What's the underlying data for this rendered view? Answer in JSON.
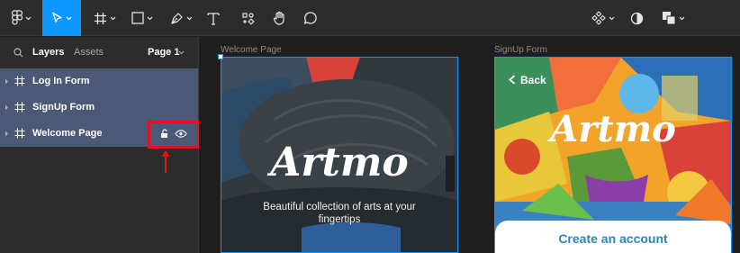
{
  "toolbar": {
    "tools": [
      {
        "name": "main-menu",
        "icon": "figma-logo-icon"
      },
      {
        "name": "move-tool",
        "icon": "cursor-arrow-icon",
        "active": true
      },
      {
        "name": "frame-tool",
        "icon": "hash-frame-icon"
      },
      {
        "name": "shape-tool",
        "icon": "rectangle-icon"
      },
      {
        "name": "pen-tool",
        "icon": "pen-nib-icon"
      },
      {
        "name": "text-tool",
        "icon": "text-t-icon"
      },
      {
        "name": "resources-tool",
        "icon": "resources-icon"
      },
      {
        "name": "hand-tool",
        "icon": "hand-icon"
      },
      {
        "name": "comment-tool",
        "icon": "comment-bubble-icon"
      },
      {
        "name": "components",
        "icon": "components-diamond-icon"
      },
      {
        "name": "contrast",
        "icon": "half-circle-icon"
      },
      {
        "name": "boolean-ops",
        "icon": "stacked-squares-icon"
      }
    ],
    "accent_color": "#0d99ff"
  },
  "sidebar": {
    "tabs": [
      "Layers",
      "Assets"
    ],
    "page_selector": "Page 1",
    "layers": [
      {
        "name": "Log In Form"
      },
      {
        "name": "SignUp Form"
      },
      {
        "name": "Welcome Page",
        "hovered": true
      }
    ],
    "layer_bg_color": "#4b5876",
    "highlight_color": "#e0141a"
  },
  "canvas": {
    "frames": [
      {
        "label": "Welcome Page",
        "title": "Artmo",
        "subtitle": "Beautiful collection of arts  at your fingertips"
      },
      {
        "label": "SignUp Form",
        "back": "Back",
        "title": "Artmo",
        "cta": "Create an account"
      }
    ]
  }
}
